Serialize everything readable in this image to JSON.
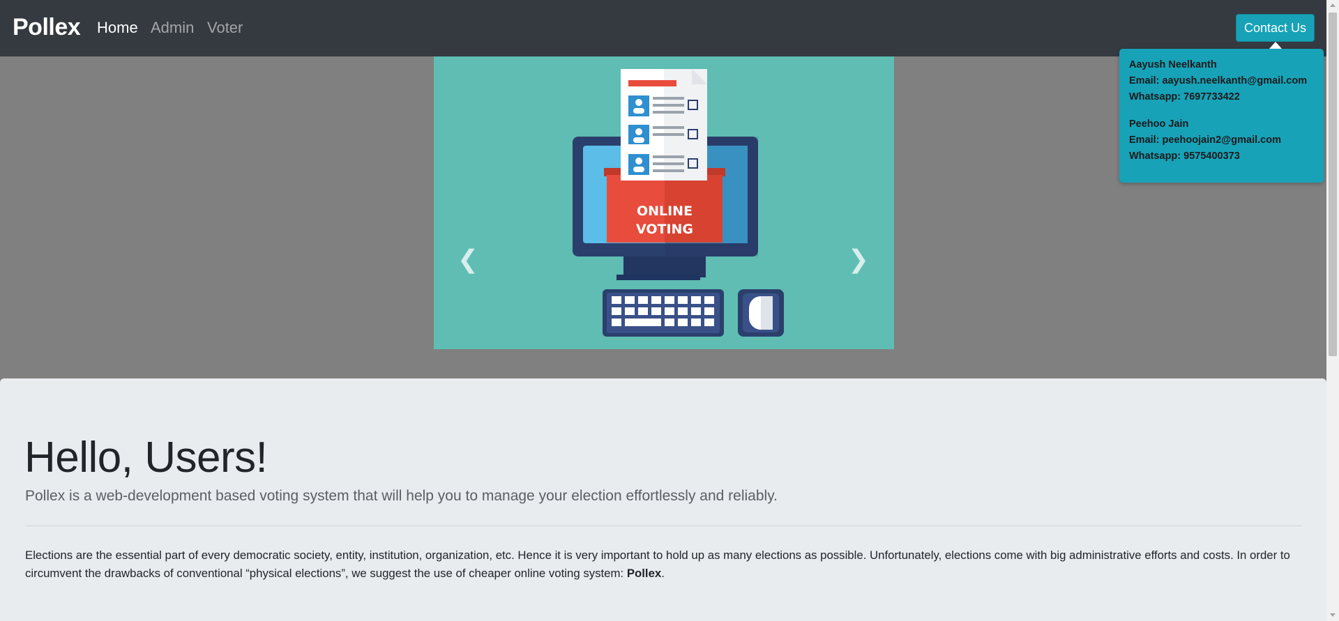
{
  "navbar": {
    "brand": "Pollex",
    "links": [
      {
        "label": "Home",
        "active": true
      },
      {
        "label": "Admin",
        "active": false
      },
      {
        "label": "Voter",
        "active": false
      }
    ],
    "contact_label": "Contact Us"
  },
  "contacts": [
    {
      "name": "Aayush Neelkanth",
      "email": "Email: aayush.neelkanth@gmail.com",
      "whatsapp": "Whatsapp: 7697733422"
    },
    {
      "name": "Peehoo Jain",
      "email": "Email: peehoojain2@gmail.com",
      "whatsapp": "Whatsapp: 9575400373"
    }
  ],
  "carousel": {
    "slide_text_line1": "ONLINE",
    "slide_text_line2": "VOTING",
    "prev_icon": "chevron-left-icon",
    "next_icon": "chevron-right-icon"
  },
  "jumbotron": {
    "title": "Hello, Users!",
    "lead": "Pollex is a web-development based voting system that will help you to manage your election effortlessly and reliably.",
    "paragraph": "Elections are the essential part of every democratic society, entity, institution, organization, etc. Hence it is very important to hold up as many elections as possible. Unfortunately, elections come with big administrative efforts and costs. In order to circumvent the drawbacks of conventional “physical elections”, we suggest the use of cheaper online voting system: ",
    "paragraph_brand": "Pollex",
    "paragraph_end": "."
  },
  "colors": {
    "navbar": "#343a40",
    "accent": "#17a2b8",
    "slide_bg": "#5fbdb3",
    "jumbotron_bg": "#e9ecef"
  }
}
